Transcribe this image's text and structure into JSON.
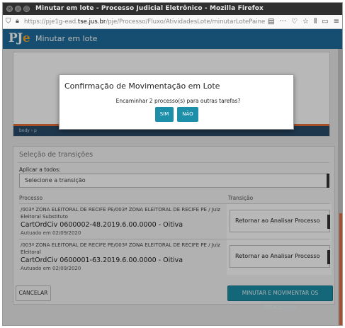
{
  "window": {
    "title": "Minutar em lote - Processo Judicial Eletrônico - Mozilla Firefox",
    "url_prefix": "https://pje1g-ead.",
    "url_domain": "tse.jus.br",
    "url_rest": "/pje/Processo/Fluxo/AtividadesLote/minutarLotePainelNovoCK",
    "toolbar_icons": [
      "shield-icon",
      "lock-icon",
      "reader-icon",
      "more-icon",
      "pocket-icon",
      "bookmark-star-icon",
      "library-icon",
      "sidebar-icon",
      "menu-icon"
    ]
  },
  "header": {
    "logo_p": "PJ",
    "logo_e": "e",
    "title": "Minutar em lote"
  },
  "editor": {
    "status_path": "body › p"
  },
  "transitions": {
    "heading": "Seleção de transições",
    "apply_label": "Aplicar a todos:",
    "apply_placeholder": "Selecione a transição",
    "col_processo": "Processo",
    "col_transicao": "Transição",
    "rows": [
      {
        "orgao": "/003ª ZONA ELEITORAL DE RECIFE PE/003ª ZONA ELEITORAL DE RECIFE PE / Juiz Eleitoral Substituto",
        "numero": "CartOrdCiv 0600002-48.2019.6.00.0000 - Oitiva",
        "autuado": "Autuado em 02/09/2020",
        "transicao": "Retornar ao Analisar Processo"
      },
      {
        "orgao": "/003ª ZONA ELEITORAL DE RECIFE PE/003ª ZONA ELEITORAL DE RECIFE PE / Juiz Eleitoral",
        "numero": "CartOrdCiv 0600001-63.2019.6.00.0000 - Oitiva",
        "autuado": "Autuado em 02/09/2020",
        "transicao": "Retornar ao Analisar Processo"
      }
    ]
  },
  "actions": {
    "cancel": "CANCELAR",
    "move": "MINUTAR E MOVIMENTAR OS PROCESSOS"
  },
  "modal": {
    "title": "Confirmação de Movimentação em Lote",
    "question": "Encaminhar 2 processo(s) para outras tarefas?",
    "yes": "SIM",
    "no": "NÃO"
  },
  "colors": {
    "header_blue": "#1e6d9c",
    "button_teal": "#1d8fa8",
    "accent_orange": "#e46d3b"
  }
}
